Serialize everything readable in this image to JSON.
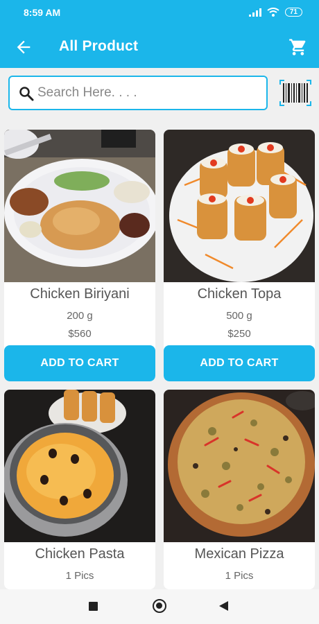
{
  "status_bar": {
    "time": "8:59 AM",
    "battery": "71"
  },
  "header": {
    "title": "All Product"
  },
  "search": {
    "placeholder": "Search Here. . . ."
  },
  "products": [
    {
      "name": "Chicken Biriyani",
      "quantity": "200 g",
      "price": "$560",
      "button": "ADD TO CART"
    },
    {
      "name": "Chicken Topa",
      "quantity": "500 g",
      "price": "$250",
      "button": "ADD TO CART"
    },
    {
      "name": "Chicken Pasta",
      "quantity": "1 Pics"
    },
    {
      "name": "Mexican Pizza",
      "quantity": "1 Pics"
    }
  ],
  "colors": {
    "primary": "#1bb6ea",
    "background": "#f0f0f0"
  },
  "icons": [
    "signal-icon",
    "wifi-icon",
    "battery-icon",
    "back-arrow-icon",
    "cart-icon",
    "search-icon",
    "barcode-icon",
    "recents-icon",
    "home-icon",
    "back-icon"
  ]
}
